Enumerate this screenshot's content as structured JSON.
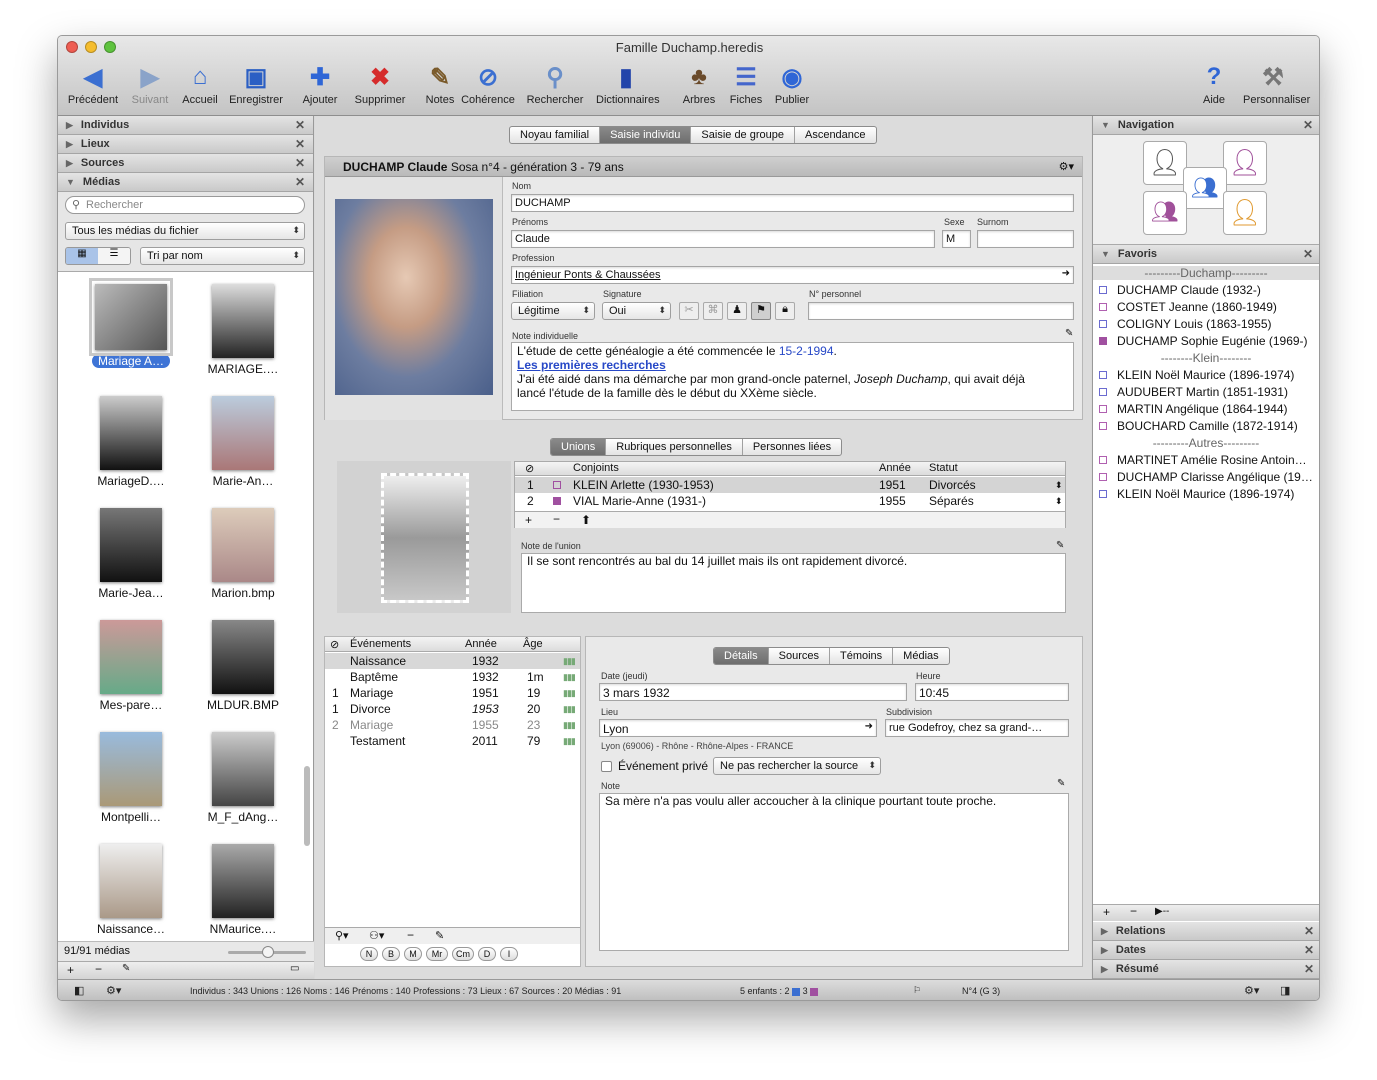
{
  "window": {
    "title": "Famille Duchamp.heredis"
  },
  "toolbar": {
    "items": [
      {
        "label": "Précédent",
        "icon": "back-arrow-icon",
        "color": "#3b6fd1"
      },
      {
        "label": "Suivant",
        "icon": "forward-arrow-icon",
        "color": "#8aa3c9"
      },
      {
        "label": "Accueil",
        "icon": "home-icon",
        "color": "#3b6fd1"
      },
      {
        "label": "Enregistrer",
        "icon": "save-icon",
        "color": "#2b5fc4"
      },
      {
        "label": "Ajouter",
        "icon": "plus-icon",
        "color": "#2f66d6"
      },
      {
        "label": "Supprimer",
        "icon": "delete-x-icon",
        "color": "#d52b2b"
      },
      {
        "label": "Notes",
        "icon": "notes-icon",
        "color": "#7a5a2a"
      },
      {
        "label": "Cohérence",
        "icon": "coherence-icon",
        "color": "#3b6fd1"
      },
      {
        "label": "Rechercher",
        "icon": "magnifier-icon",
        "color": "#6a8fc9"
      },
      {
        "label": "Dictionnaires",
        "icon": "dictionary-icon",
        "color": "#2244aa"
      },
      {
        "label": "Arbres",
        "icon": "tree-icon",
        "color": "#6a4a2a"
      },
      {
        "label": "Fiches",
        "icon": "cards-icon",
        "color": "#4466cc"
      },
      {
        "label": "Publier",
        "icon": "globe-icon",
        "color": "#2f66d6"
      },
      {
        "label": "Aide",
        "icon": "help-icon",
        "color": "#2f66d6"
      },
      {
        "label": "Personnaliser",
        "icon": "tools-icon",
        "color": "#777777"
      }
    ]
  },
  "left": {
    "sections": [
      "Individus",
      "Lieux",
      "Sources",
      "Médias"
    ],
    "search_placeholder": "Rechercher",
    "filter": "Tous les médias du fichier",
    "sort": "Tri par nom",
    "thumbs": [
      "Mariage A…",
      "MARIAGE.…",
      "MariageD.…",
      "Marie-An…",
      "Marie-Jea…",
      "Marion.bmp",
      "Mes-pare…",
      "MLDUR.BMP",
      "Montpelli…",
      "M_F_dAng…",
      "Naissance…",
      "NMaurice.…"
    ],
    "count": "91/91 médias"
  },
  "center": {
    "tabs": [
      "Noyau familial",
      "Saisie individu",
      "Saisie de groupe",
      "Ascendance"
    ],
    "person_name": "DUCHAMP Claude",
    "person_info": "Sosa n°4 - génération 3 - 79 ans",
    "labels": {
      "nom": "Nom",
      "prenoms": "Prénoms",
      "sexe": "Sexe",
      "surnom": "Surnom",
      "profession": "Profession",
      "filiation": "Filiation",
      "signature": "Signature",
      "num": "N° personnel",
      "note": "Note individuelle"
    },
    "values": {
      "nom": "DUCHAMP",
      "prenoms": "Claude",
      "sexe": "M",
      "surnom": "",
      "profession": "Ingénieur Ponts & Chaussées",
      "filiation": "Légitime",
      "signature": "Oui",
      "num": ""
    },
    "note": {
      "l1a": "L'étude de cette généalogie a été commencée le ",
      "l1b": "15-2-1994",
      "l1c": ".",
      "link": "Les premières recherches",
      "l3a": "J'ai été aidé dans ma démarche par mon grand-oncle paternel, ",
      "l3b": "Joseph Duchamp",
      "l3c": ", qui avait déjà",
      "l4": "lancé l'étude de la famille dès le début du XXème siècle."
    },
    "union_tabs": [
      "Unions",
      "Rubriques personnelles",
      "Personnes liées"
    ],
    "union_cols": [
      "Conjoints",
      "Année",
      "Statut"
    ],
    "unions": [
      {
        "n": "1",
        "name": "KLEIN Arlette (1930-1953)",
        "year": "1951",
        "status": "Divorcés"
      },
      {
        "n": "2",
        "name": "VIAL Marie-Anne (1931-)",
        "year": "1955",
        "status": "Séparés"
      }
    ],
    "union_note_label": "Note de l'union",
    "union_note": "Il se sont rencontrés au bal du 14 juillet mais ils ont rapidement divorcé.",
    "event_cols": [
      "Événements",
      "Année",
      "Âge"
    ],
    "events": [
      {
        "n": "",
        "name": "Naissance",
        "year": "1932",
        "age": ""
      },
      {
        "n": "",
        "name": "Baptême",
        "year": "1932",
        "age": "1m"
      },
      {
        "n": "1",
        "name": "Mariage",
        "year": "1951",
        "age": "19"
      },
      {
        "n": "1",
        "name": "Divorce",
        "year": "1953",
        "age": "20"
      },
      {
        "n": "2",
        "name": "Mariage",
        "year": "1955",
        "age": "23"
      },
      {
        "n": "",
        "name": "Testament",
        "year": "2011",
        "age": "79"
      }
    ],
    "filters": [
      "N",
      "B",
      "M",
      "Mr",
      "Cm",
      "D",
      "I"
    ],
    "detail_tabs": [
      "Détails",
      "Sources",
      "Témoins",
      "Médias"
    ],
    "detail": {
      "date_label": "Date (jeudi)",
      "date": "3 mars 1932",
      "heure_label": "Heure",
      "heure": "10:45",
      "lieu_label": "Lieu",
      "lieu": "Lyon",
      "subdiv_label": "Subdivision",
      "subdiv": "rue Godefroy,  chez sa grand-…",
      "lieu_full": "Lyon (69006) - Rhône - Rhône-Alpes - FRANCE",
      "prive": "Événement privé",
      "source_sel": "Ne pas rechercher la source",
      "note_label": "Note",
      "note": "Sa mère n'a pas voulu aller accoucher à la clinique pourtant toute proche."
    }
  },
  "right": {
    "navigation": "Navigation",
    "favoris": "Favoris",
    "bottom": [
      "Relations",
      "Dates",
      "Résumé"
    ],
    "fav": [
      {
        "t": "sep",
        "label": "---------Duchamp---------"
      },
      {
        "t": "m",
        "label": "DUCHAMP Claude (1932-)"
      },
      {
        "t": "f",
        "label": "COSTET Jeanne (1860-1949)"
      },
      {
        "t": "m",
        "label": "COLIGNY Louis (1863-1955)"
      },
      {
        "t": "ff",
        "label": "DUCHAMP Sophie Eugénie (1969-)"
      },
      {
        "t": "sep",
        "label": "--------Klein--------"
      },
      {
        "t": "m",
        "label": "KLEIN Noël Maurice (1896-1974)"
      },
      {
        "t": "m",
        "label": "AUDUBERT Martin (1851-1931)"
      },
      {
        "t": "f",
        "label": "MARTIN Angélique (1864-1944)"
      },
      {
        "t": "f",
        "label": "BOUCHARD Camille (1872-1914)"
      },
      {
        "t": "sep",
        "label": "---------Autres---------"
      },
      {
        "t": "f",
        "label": "MARTINET Amélie Rosine Antoin…"
      },
      {
        "t": "f",
        "label": "DUCHAMP Clarisse Angélique (19…"
      },
      {
        "t": "m",
        "label": "KLEIN Noël Maurice (1896-1974)"
      }
    ]
  },
  "status": {
    "stats": "Individus : 343   Unions : 126   Noms : 146   Prénoms : 140   Professions : 73   Lieux : 67   Sources : 20   Médias : 91",
    "enfants": "5 enfants :  2",
    "enfants2": "3",
    "sosa": "N°4 (G 3)"
  }
}
